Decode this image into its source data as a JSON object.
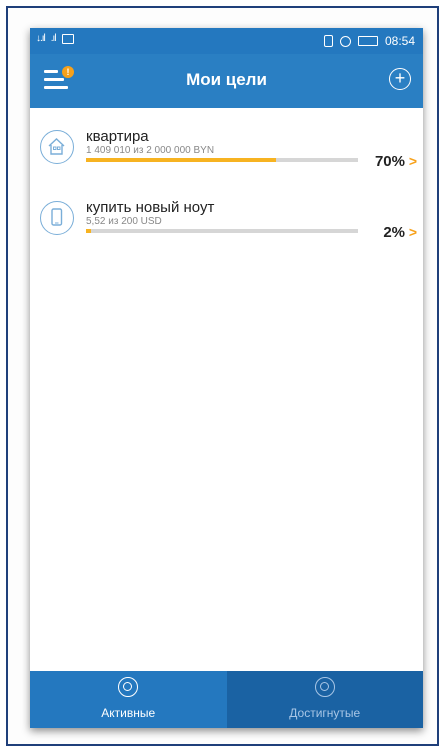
{
  "status_bar": {
    "signal_1": "↓.ıl",
    "signal_2": ".ıl",
    "time": "08:54"
  },
  "app_bar": {
    "title": "Мои цели",
    "badge": "!"
  },
  "goals": [
    {
      "name": "квартира",
      "subtitle": "1 409 010 из 2 000 000 BYN",
      "percent": "70%",
      "progress": 0.7,
      "icon": "house-icon"
    },
    {
      "name": "купить новый ноут",
      "subtitle": "5,52 из 200 USD",
      "percent": "2%",
      "progress": 0.02,
      "icon": "phone-icon"
    }
  ],
  "tabs": [
    {
      "label": "Активные",
      "icon": "target-icon",
      "active": true
    },
    {
      "label": "Достигнутые",
      "icon": "target-hit-icon",
      "active": false
    }
  ],
  "colors": {
    "primary": "#2a7fc3",
    "accent": "#f7b321",
    "progress_track": "#d6d6d6"
  }
}
